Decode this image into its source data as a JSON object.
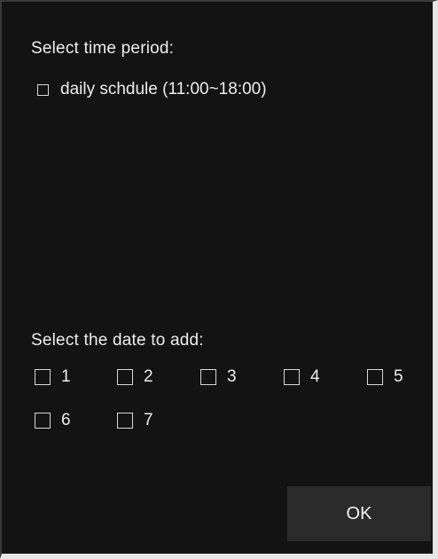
{
  "dialog": {
    "period_label": "Select time period:",
    "period_option": "daily schdule (11:00~18:00)",
    "date_label": "Select the date to add:",
    "days": [
      "1",
      "2",
      "3",
      "4",
      "5",
      "6",
      "7"
    ],
    "ok_label": "OK"
  }
}
